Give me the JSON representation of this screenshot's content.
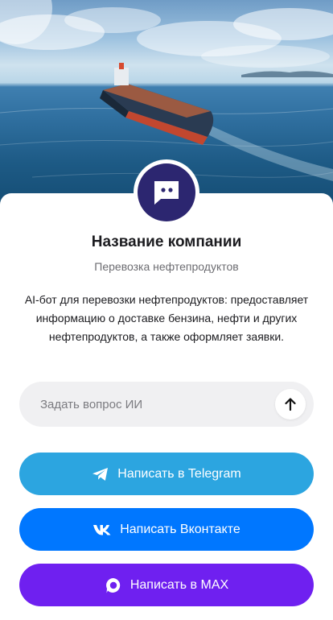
{
  "hero": {
    "image": "oil-tanker-at-sea"
  },
  "company": {
    "name": "Название компании",
    "subtitle": "Перевозка нефтепродуктов",
    "description": "AI-бот для перевозки нефтепродуктов: предоставляет информацию о доставке бензина, нефти и других нефтепродуктов, а также оформляет заявки.",
    "avatar_icon": "chat-bubble-icon"
  },
  "ask": {
    "placeholder": "Задать вопрос ИИ",
    "value": "",
    "send_icon": "arrow-up-icon"
  },
  "buttons": {
    "telegram": {
      "label": "Написать в Telegram",
      "icon": "telegram-icon",
      "color": "#2ca5e0"
    },
    "vk": {
      "label": "Написать Вконтакте",
      "icon": "vk-icon",
      "color": "#0077ff"
    },
    "max": {
      "label": "Написать в MAX",
      "icon": "max-icon",
      "color": "#6f20f0"
    }
  }
}
